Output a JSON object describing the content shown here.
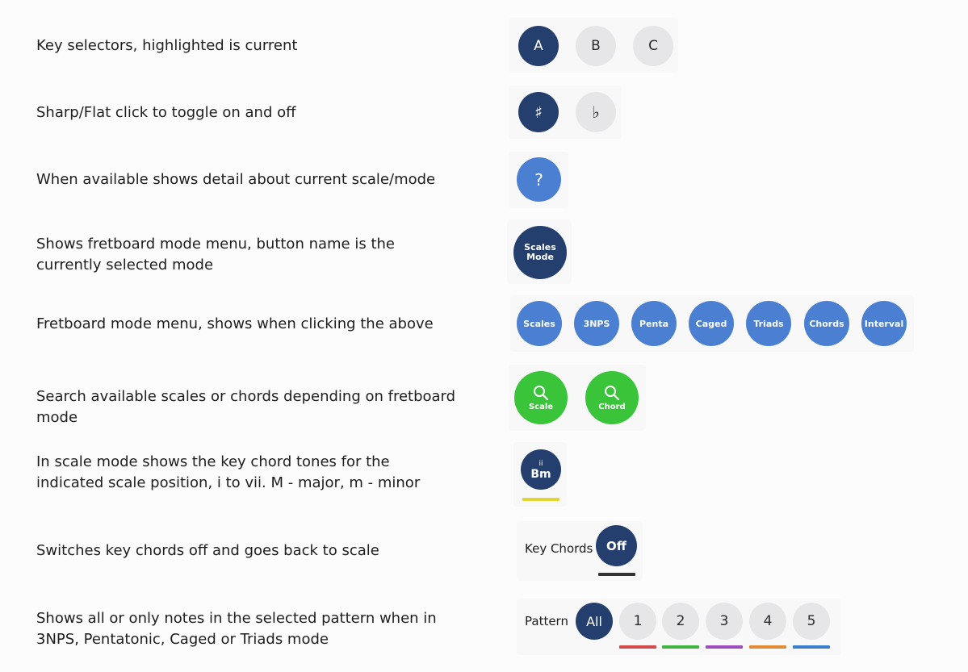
{
  "rows": [
    {
      "id": "key-selectors",
      "text": "Key selectors, highlighted is current"
    },
    {
      "id": "sharp-flat",
      "text": "Sharp/Flat click to toggle on and off"
    },
    {
      "id": "detail",
      "text": "When available shows detail about current scale/mode"
    },
    {
      "id": "mode-menu-button",
      "text": "Shows fretboard mode menu, button name is the currently selected mode"
    },
    {
      "id": "mode-menu",
      "text": "Fretboard mode menu, shows when clicking the above"
    },
    {
      "id": "search",
      "text": "Search available scales or chords depending on fretboard mode"
    },
    {
      "id": "key-chord-tones",
      "text": "In scale mode shows the key chord tones for the indicated scale position, i to vii. M - major,  m - minor"
    },
    {
      "id": "key-chords-off",
      "text": "Switches key chords off and goes back to scale"
    },
    {
      "id": "pattern",
      "text": "Shows all or only notes in the selected pattern when in 3NPS, Pentatonic, Caged or Triads mode"
    }
  ],
  "keys": [
    "A",
    "B",
    "C"
  ],
  "accidentals": {
    "sharp": "♯",
    "flat": "♭"
  },
  "help_label": "?",
  "current_mode": {
    "line1": "Scales",
    "line2": "Mode"
  },
  "modes": [
    "Scales",
    "3NPS",
    "Penta",
    "Caged",
    "Triads",
    "Chords",
    "Interval"
  ],
  "search": {
    "scale_label": "Scale",
    "chord_label": "Chord",
    "icon": "search-icon"
  },
  "chord_tone": {
    "degree": "ii",
    "name": "Bm",
    "underline_color": "#e3d536"
  },
  "key_chords": {
    "label": "Key Chords",
    "button": "Off",
    "underline_color": "#333333"
  },
  "pattern": {
    "label": "Pattern",
    "buttons": [
      "All",
      "1",
      "2",
      "3",
      "4",
      "5"
    ],
    "colors": [
      "#d14b4b",
      "#3fb53f",
      "#9a4dbb",
      "#e08a35",
      "#3a7ec9"
    ]
  },
  "colors": {
    "navy": "#243f6e",
    "grey": "#e6e6e9",
    "blue": "#4a7fd1",
    "green": "#3ac43a"
  }
}
